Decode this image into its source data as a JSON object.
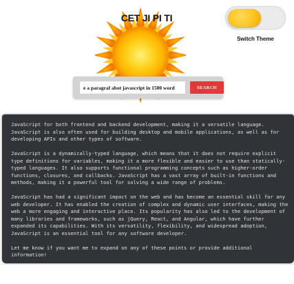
{
  "header": {
    "title": "CET JI PI TI",
    "logo_icon": "sun-icon"
  },
  "theme_toggle": {
    "label": "Switch Theme",
    "state": "light",
    "knob_color": "#ffc41f"
  },
  "search": {
    "value": "e a paragraf abot javascript in 1500 word",
    "button_label": "SEARCH",
    "button_color": "#e03a3a"
  },
  "result": {
    "paragraphs": [
      "JavaScript for both frontend and backend development, making it a versatile language. JavaScript is also often used for building desktop and mobile applications, as well as for developing APIs and other types of software.",
      "JavaScript is a dynamically-typed language, which means that it does not require explicit type definitions for variables, making it a more flexible and easier to use than statically-typed languages. It also supports functional programming concepts such as higher-order functions, closures, and callbacks. JavaScript has a vast array of built-in functions and methods, making it a powerful tool for solving a wide range of problems.",
      "JavaScript has had a significant impact on the web and has become an essential skill for any web developer. It has enabled the creation of complex and dynamic user interfaces, making the web a more engaging and interactive place. Its popularity has also led to the development of many libraries and frameworks, such as jQuery, React, and Angular, which have further expanded its capabilities. With its versatility, flexibility, and widespread adoption, JavaScript is an essential tool for any software developer.",
      "Let me know if you want me to expand on any of these points or provide additional information!"
    ],
    "background": "#303338",
    "text_color": "#e2e2e2"
  }
}
